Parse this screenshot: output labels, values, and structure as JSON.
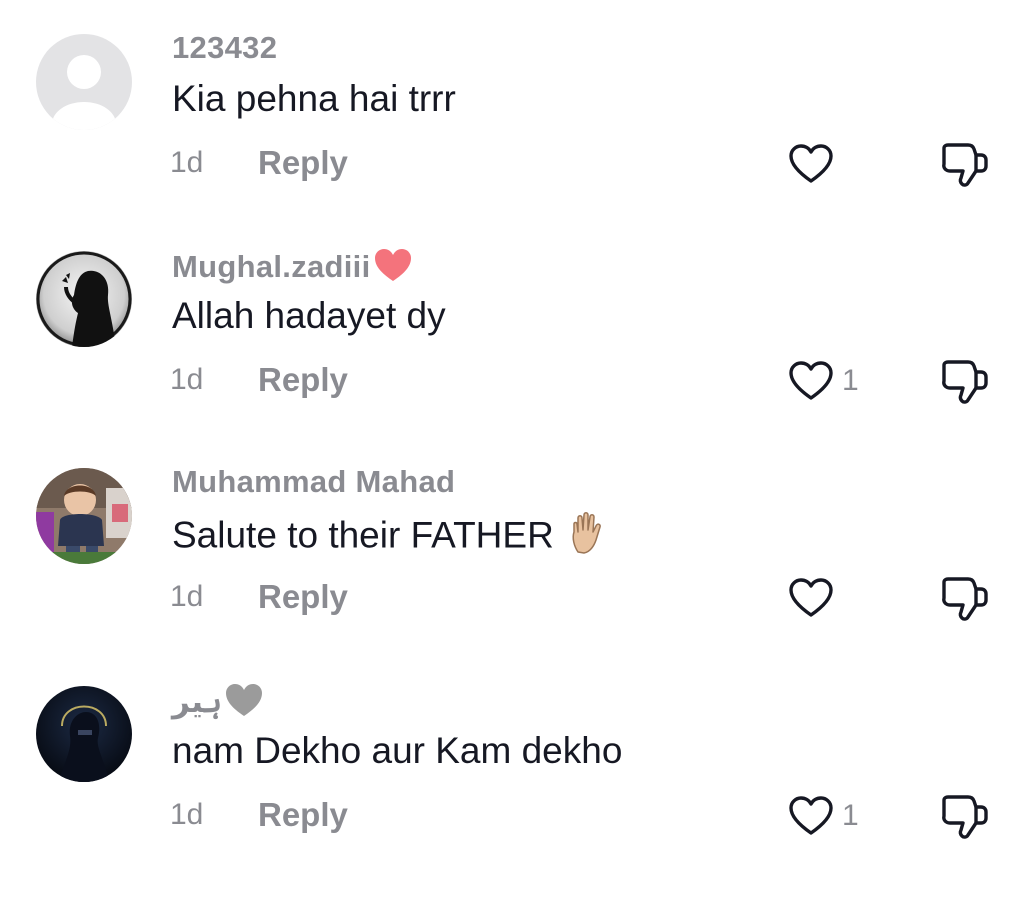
{
  "comments": [
    {
      "username": "123432",
      "text": "Kia pehna hai trrr",
      "time": "1d",
      "reply_label": "Reply",
      "like_count": "",
      "avatar": "default-avatar",
      "username_emoji": "",
      "text_emoji": ""
    },
    {
      "username": "Mughal.zadiii",
      "text": "Allah hadayet dy",
      "time": "1d",
      "reply_label": "Reply",
      "like_count": "1",
      "avatar": "silhouette-avatar",
      "username_emoji": "pink-heart",
      "text_emoji": ""
    },
    {
      "username": "Muhammad Mahad",
      "text": "Salute to their FATHER",
      "time": "1d",
      "reply_label": "Reply",
      "like_count": "",
      "avatar": "baby-photo-avatar",
      "username_emoji": "",
      "text_emoji": "raised-hand"
    },
    {
      "username": "ہیر",
      "text": "nam Dekho aur Kam dekho",
      "time": "1d",
      "reply_label": "Reply",
      "like_count": "1",
      "avatar": "dark-portrait-avatar",
      "username_emoji": "grey-heart",
      "text_emoji": ""
    }
  ],
  "colors": {
    "primary_text": "#161823",
    "secondary_text": "#8a8b91",
    "pink_heart": "#f4737c",
    "grey_heart": "#9b9b9b",
    "icon_stroke": "#161823"
  }
}
